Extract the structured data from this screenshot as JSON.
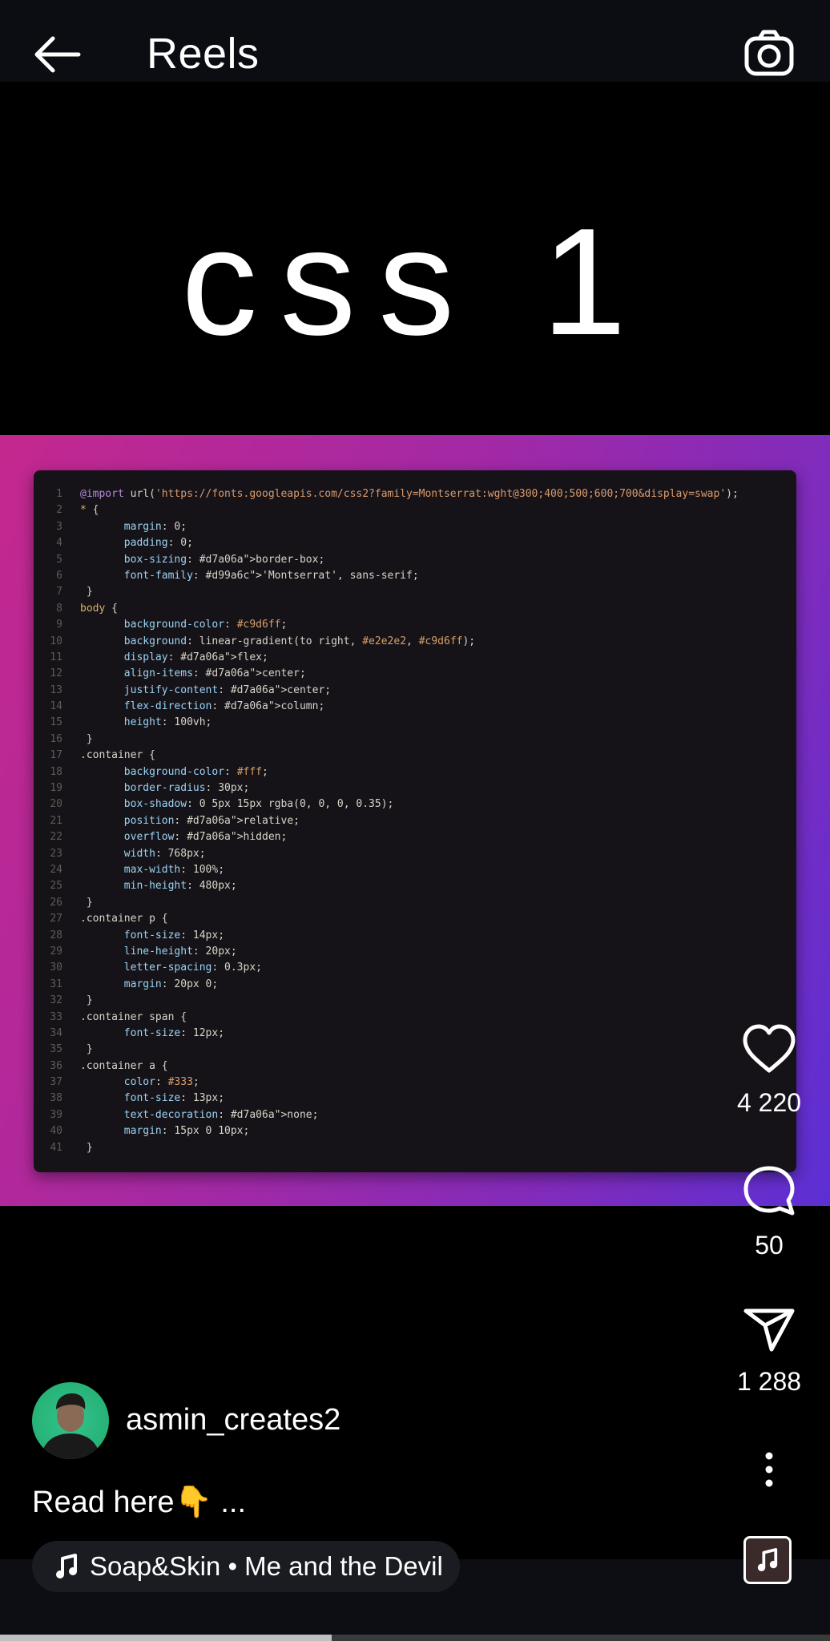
{
  "header": {
    "title": "Reels",
    "back_icon": "arrow-left-icon",
    "camera_icon": "camera-icon"
  },
  "video": {
    "overlay_text": "css 1",
    "code_lines": [
      "@import url('https://fonts.googleapis.com/css2?family=Montserrat:wght@300;400;500;600;700&display=swap');",
      "* {",
      "    margin: 0;",
      "    padding: 0;",
      "    box-sizing: border-box;",
      "    font-family: 'Montserrat', sans-serif;",
      "}",
      "body {",
      "    background-color: #c9d6ff;",
      "    background: linear-gradient(to right, #e2e2e2, #c9d6ff);",
      "    display: flex;",
      "    align-items: center;",
      "    justify-content: center;",
      "    flex-direction: column;",
      "    height: 100vh;",
      "}",
      ".container {",
      "    background-color: #fff;",
      "    border-radius: 30px;",
      "    box-shadow: 0 5px 15px rgba(0, 0, 0, 0.35);",
      "    position: relative;",
      "    overflow: hidden;",
      "    width: 768px;",
      "    max-width: 100%;",
      "    min-height: 480px;",
      "}",
      ".container p {",
      "    font-size: 14px;",
      "    line-height: 20px;",
      "    letter-spacing: 0.3px;",
      "    margin: 20px 0;",
      "}",
      ".container span {",
      "    font-size: 12px;",
      "}",
      ".container a {",
      "    color: #333;",
      "    font-size: 13px;",
      "    text-decoration: none;",
      "    margin: 15px 0 10px;",
      "}"
    ],
    "gradient_colors": [
      "#c4288e",
      "#5c2fd4"
    ]
  },
  "actions": {
    "like": {
      "icon": "heart-icon",
      "count": "4 220"
    },
    "comment": {
      "icon": "comment-icon",
      "count": "50"
    },
    "share": {
      "icon": "send-icon",
      "count": "1 288"
    },
    "more": {
      "icon": "more-vertical-icon"
    }
  },
  "author": {
    "username": "asmin_creates2",
    "avatar": "avatar"
  },
  "caption": "Read here👇 ...",
  "music": {
    "icon": "music-note-icon",
    "label": "Soap&Skin • Me and the Devil"
  },
  "progress": 0.4
}
